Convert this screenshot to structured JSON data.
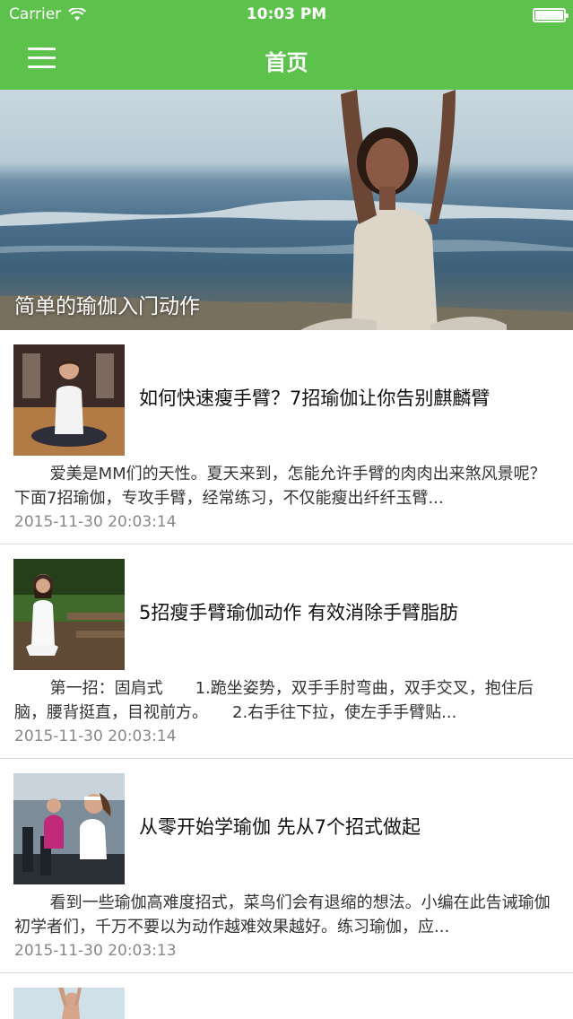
{
  "status_bar": {
    "carrier": "Carrier",
    "time": "10:03 PM",
    "icons": [
      "wifi-icon",
      "battery-icon"
    ]
  },
  "nav": {
    "title": "首页",
    "menu_icon": "menu-icon"
  },
  "colors": {
    "accent": "#5dc24c",
    "title_text": "#111111",
    "body_text": "#333333",
    "date_text": "#888888",
    "divider": "#dcdcdc"
  },
  "banner": {
    "caption": "简单的瑜伽入门动作"
  },
  "articles": [
    {
      "title": "如何快速瘦手臂？7招瑜伽让你告别麒麟臂",
      "excerpt": "爱美是MM们的天性。夏天来到，怎能允许手臂的肉肉出来煞风景呢？下面7招瑜伽，专攻手臂，经常练习，不仅能瘦出纤纤玉臂...",
      "date": "2015-11-30 20:03:14"
    },
    {
      "title": "5招瘦手臂瑜伽动作 有效消除手臂脂肪",
      "excerpt": "第一招：固肩式　　1.跪坐姿势，双手手肘弯曲，双手交叉，抱住后脑，腰背挺直，目视前方。　　2.右手往下拉，使左手手臂贴...",
      "date": "2015-11-30 20:03:14"
    },
    {
      "title": "从零开始学瑜伽 先从7个招式做起",
      "excerpt": "看到一些瑜伽高难度招式，菜鸟们会有退缩的想法。小编在此告诫瑜伽初学者们，千万不要以为动作越难效果越好。练习瑜伽，应...",
      "date": "2015-11-30 20:03:13"
    }
  ]
}
